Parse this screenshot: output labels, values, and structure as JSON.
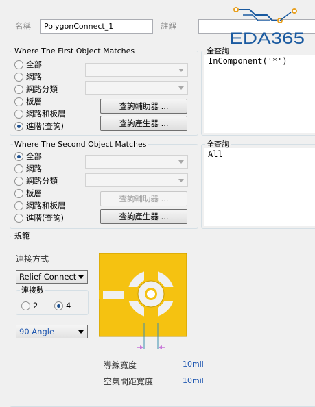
{
  "header": {
    "name_label": "名稱",
    "name_value": "PolygonConnect_1",
    "comment_label": "註解",
    "comment_value": "",
    "watermark": "EDA365"
  },
  "first": {
    "title": "Where The First Object Matches",
    "options": [
      "全部",
      "網路",
      "網路分類",
      "板層",
      "網路和板層",
      "進階(查詢)"
    ],
    "selected": 5,
    "helper_button": "查詢輔助器 ...",
    "builder_button": "查詢產生器 ...",
    "query_title": "全查詢",
    "query": "InComponent('*')"
  },
  "second": {
    "title": "Where The Second Object Matches",
    "options": [
      "全部",
      "網路",
      "網路分類",
      "板層",
      "網路和板層",
      "進階(查詢)"
    ],
    "selected": 0,
    "helper_button": "查詢輔助器 ...",
    "builder_button": "查詢產生器 ...",
    "query_title": "全查詢",
    "query": "All"
  },
  "constraints": {
    "title": "規範",
    "connect_style_label": "連接方式",
    "connect_style_value": "Relief Connect",
    "conductors_title": "連接數",
    "conductor_options": [
      "2",
      "4"
    ],
    "conductors_selected": "4",
    "angle_value": "90 Angle",
    "conductor_width_label": "導線寬度",
    "conductor_width_value": "10mil",
    "air_gap_label": "空氣間距寬度",
    "air_gap_value": "10mil"
  },
  "colors": {
    "copper": "#f5c211",
    "copper_edge": "#c99a00",
    "arrow": "#c878d8",
    "guide": "#3a8fb0"
  }
}
